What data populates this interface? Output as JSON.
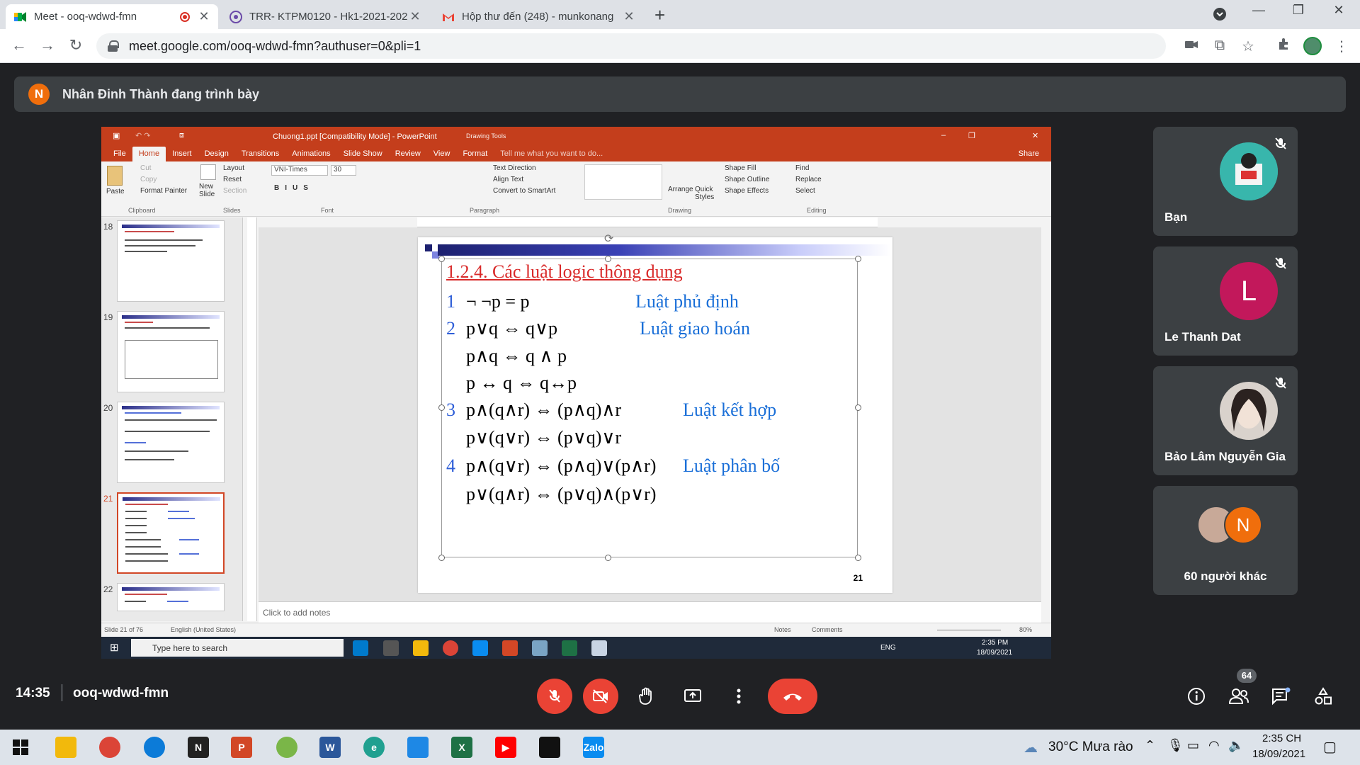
{
  "browser": {
    "tabs": [
      {
        "title": "Meet - ooq-wdwd-fmn",
        "active": true
      },
      {
        "title": "TRR- KTPM0120 - Hk1-2021-202",
        "active": false
      },
      {
        "title": "Hộp thư đến (248) - munkonang",
        "active": false
      }
    ],
    "url": "meet.google.com/ooq-wdwd-fmn?authuser=0&pli=1"
  },
  "meet": {
    "presenting_initial": "N",
    "presenting_text": "Nhân Đinh Thành đang trình bày",
    "clock": "14:35",
    "meeting_code": "ooq-wdwd-fmn",
    "participant_count": "64",
    "participants": [
      {
        "name": "Bạn",
        "avatar": "photo"
      },
      {
        "name": "Le Thanh Dat",
        "initial": "L",
        "color": "#c2185b"
      },
      {
        "name": "Bảo Lâm Nguyễn Gia",
        "avatar": "photo"
      },
      {
        "name": "60 người khác",
        "initial": "N",
        "color": "#f06e0c"
      }
    ]
  },
  "powerpoint": {
    "window_title": "Chuong1.ppt [Compatibility Mode] - PowerPoint",
    "drawing_tools": "Drawing Tools",
    "tell_me": "Tell me what you want to do...",
    "share": "Share",
    "ribbon_tabs": [
      "File",
      "Home",
      "Insert",
      "Design",
      "Transitions",
      "Animations",
      "Slide Show",
      "Review",
      "View",
      "Format"
    ],
    "clipboard": {
      "paste": "Paste",
      "cut": "Cut",
      "copy": "Copy",
      "format_painter": "Format Painter",
      "label": "Clipboard"
    },
    "slides": {
      "new_slide": "New Slide",
      "layout": "Layout",
      "reset": "Reset",
      "section": "Section",
      "label": "Slides"
    },
    "font": {
      "name": "VNI-Times",
      "size": "30",
      "label": "Font"
    },
    "paragraph": {
      "text_direction": "Text Direction",
      "align_text": "Align Text",
      "convert": "Convert to SmartArt",
      "label": "Paragraph"
    },
    "drawing": {
      "arrange": "Arrange",
      "quick_styles": "Quick Styles",
      "shape_fill": "Shape Fill",
      "shape_outline": "Shape Outline",
      "shape_effects": "Shape Effects",
      "label": "Drawing"
    },
    "editing": {
      "find": "Find",
      "replace": "Replace",
      "select": "Select",
      "label": "Editing"
    },
    "thumbnails": [
      "18",
      "19",
      "20",
      "21",
      "22"
    ],
    "slide": {
      "title": "1.2.4. Các luật logic thông dụng",
      "rows": [
        {
          "num": "1",
          "expr": "¬ ¬p = p",
          "law": "Luật phủ định"
        },
        {
          "num": "2",
          "expr": "p∨q ⇔ q∨p",
          "law": "Luật giao hoán"
        },
        {
          "num": "",
          "expr": "p∧q ⇔ q ∧ p",
          "law": ""
        },
        {
          "num": "",
          "expr": "p ↔ q ⇔ q↔p",
          "law": ""
        },
        {
          "num": "3",
          "expr": "p∧(q∧r) ⇔ (p∧q)∧r",
          "law": "Luật kết hợp"
        },
        {
          "num": "",
          "expr": "p∨(q∨r) ⇔ (p∨q)∨r",
          "law": ""
        },
        {
          "num": "4",
          "expr": "p∧(q∨r) ⇔ (p∧q)∨(p∧r)",
          "law": "Luật phân bố"
        },
        {
          "num": "",
          "expr": "p∨(q∧r) ⇔ (p∨q)∧(p∨r)",
          "law": ""
        }
      ],
      "page_number": "21"
    },
    "notes_placeholder": "Click to add notes",
    "status": {
      "slide_of": "Slide 21 of 76",
      "language": "English (United States)",
      "notes": "Notes",
      "comments": "Comments",
      "zoom": "80%"
    },
    "inner_taskbar": {
      "search": "Type here to search",
      "lang": "ENG",
      "time": "2:35 PM",
      "date": "18/09/2021"
    }
  },
  "windows_taskbar": {
    "weather": "30°C  Mưa rào",
    "time": "2:35 CH",
    "date": "18/09/2021"
  }
}
